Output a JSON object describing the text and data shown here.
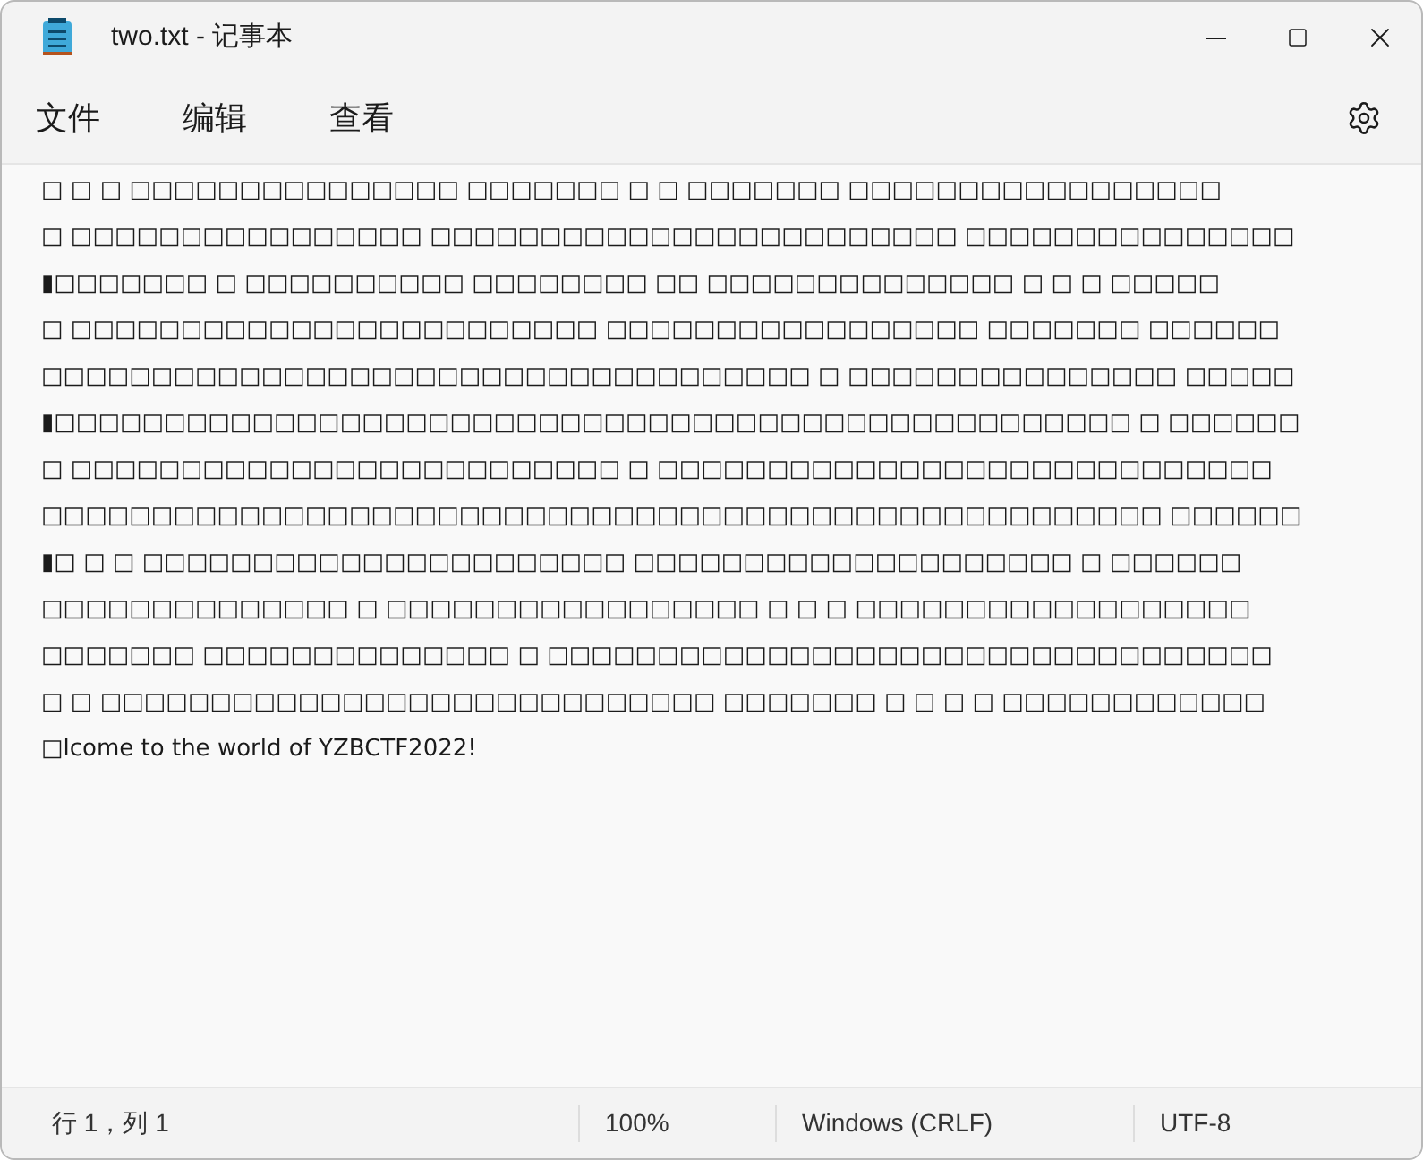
{
  "window": {
    "title": "two.txt - 记事本"
  },
  "menu": [
    "文件",
    "编辑",
    "查看"
  ],
  "editor": {
    "lines": [
      "□ □ □ □□□□□□□□□□□□□□□ □□□□□□□ □ □ □□□□□□□ □□□□□□□□□□□□□□□□□",
      "□ □□□□□□□□□□□□□□□□ □□□□□□□□□□□□□□□□□□□□□□□□ □□□□□□□□□□□□□□□",
      "▮□□□□□□□ □ □□□□□□□□□□ □□□□□□□□ □□ □□□□□□□□□□□□□□ □ □ □ □□□□□",
      "□ □□□□□□□□□□□□□□□□□□□□□□□□ □□□□□□□□□□□□□□□□□ □□□□□□□ □□□□□□",
      "□□□□□□□□□□□□□□□□□□□□□□□□□□□□□□□□□□□ □ □□□□□□□□□□□□□□□ □□□□□",
      "▮□□□□□□□□□□□□□□□□□□□□□□□□□□□□□□□□□□□□□□□□□□□□□□□□□ □ □□□□□□",
      "□ □□□□□□□□□□□□□□□□□□□□□□□□□ □ □□□□□□□□□□□□□□□□□□□□□□□□□□□□",
      "□□□□□□□□□□□□□□□□□□□□□□□□□□□□□□□□□□□□□□□□□□□□□□□□□□□ □□□□□□",
      "▮□ □ □ □□□□□□□□□□□□□□□□□□□□□□ □□□□□□□□□□□□□□□□□□□□ □ □□□□□□",
      "□□□□□□□□□□□□□□ □ □□□□□□□□□□□□□□□□□ □ □ □ □□□□□□□□□□□□□□□□□□",
      "□□□□□□□ □□□□□□□□□□□□□□ □ □□□□□□□□□□□□□□□□□□□□□□□□□□□□□□□□□",
      "□ □ □□□□□□□□□□□□□□□□□□□□□□□□□□□□ □□□□□□□ □ □ □ □ □□□□□□□□□□□□",
      "□lcome to the world of YZBCTF2022!"
    ]
  },
  "status_bar": [
    "行 1，列 1",
    "100%",
    "Windows (CRLF)",
    "UTF-8"
  ]
}
